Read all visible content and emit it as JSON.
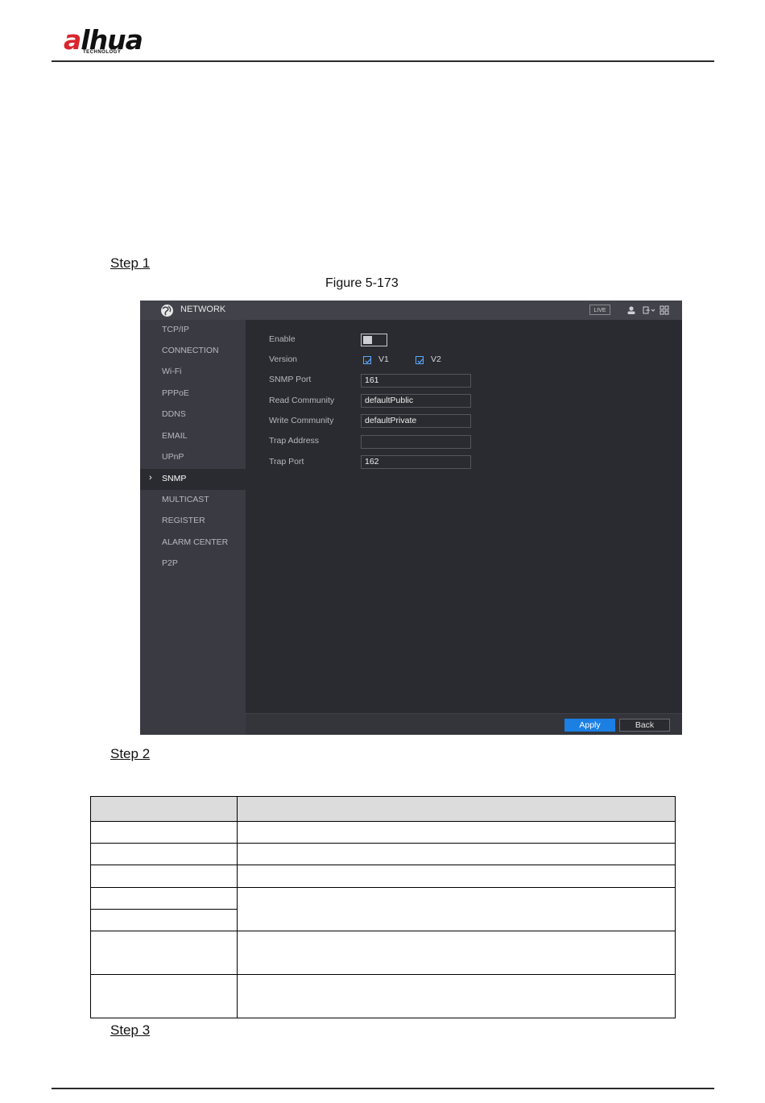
{
  "header": {
    "logo_text": "alhua",
    "logo_subtext": "TECHNOLOGY"
  },
  "steps": {
    "step1": "Step 1",
    "step2": "Step 2",
    "step3": "Step 3"
  },
  "figure": {
    "caption": "Figure 5-173"
  },
  "ui": {
    "title": "NETWORK",
    "live_badge": "LIVE",
    "sidebar": {
      "items": [
        {
          "label": "TCP/IP"
        },
        {
          "label": "CONNECTION"
        },
        {
          "label": "Wi-Fi"
        },
        {
          "label": "PPPoE"
        },
        {
          "label": "DDNS"
        },
        {
          "label": "EMAIL"
        },
        {
          "label": "UPnP"
        },
        {
          "label": "SNMP",
          "active": true
        },
        {
          "label": "MULTICAST"
        },
        {
          "label": "REGISTER"
        },
        {
          "label": "ALARM CENTER"
        },
        {
          "label": "P2P"
        }
      ],
      "active_marker": "›"
    },
    "form": {
      "enable_label": "Enable",
      "enable_on": false,
      "version_label": "Version",
      "v1_label": "V1",
      "v1_checked": true,
      "v2_label": "V2",
      "v2_checked": true,
      "snmp_port_label": "SNMP Port",
      "snmp_port_value": "161",
      "read_community_label": "Read Community",
      "read_community_value": "defaultPublic",
      "write_community_label": "Write Community",
      "write_community_value": "defaultPrivate",
      "trap_address_label": "Trap Address",
      "trap_address_value": "",
      "trap_port_label": "Trap Port",
      "trap_port_value": "162"
    },
    "buttons": {
      "apply": "Apply",
      "back": "Back"
    }
  },
  "colors": {
    "accent_blue": "#1b7fe4",
    "logo_red": "#d8262d",
    "ui_background": "#2a2b30",
    "ui_sidebar": "#3a3b42"
  }
}
